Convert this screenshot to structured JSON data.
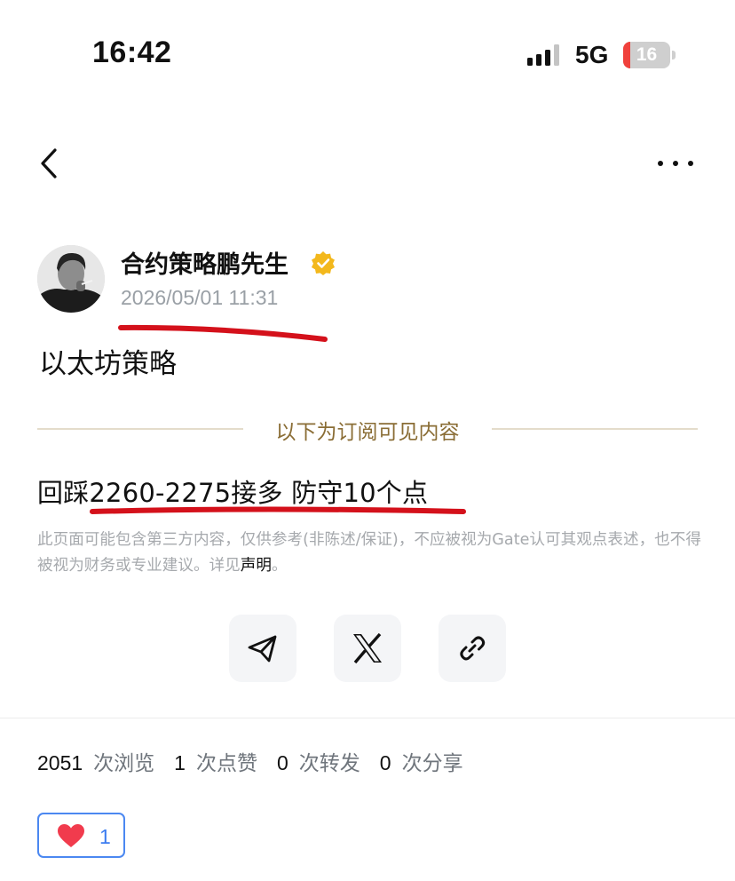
{
  "status_bar": {
    "time": "16:42",
    "network": "5G",
    "battery": "16",
    "battery_level": 0.16,
    "battery_color": "#f0413c",
    "signal_bars_active": 3,
    "signal_bars_total": 4
  },
  "nav": {
    "back_icon": "chevron-left-icon",
    "more_icon": "more-horizontal-icon"
  },
  "post": {
    "author": "合约策略鹏先生",
    "verified_icon": "verified-badge-icon",
    "verified_color": "#f3b81c",
    "timestamp": "2026/05/01 11:31",
    "title": "以太坊策略",
    "subscription_label": "以下为订阅可见内容",
    "subscription_color": "#8a6d35",
    "strategy_text": "回踩2260-2275接多 防守10个点",
    "disclaimer_text": "此页面可能包含第三方内容，仅供参考(非陈述/保证)，不应被视为Gate认可其观点表述，也不得被视为财务或专业建议。详见",
    "disclaimer_link": "声明",
    "disclaimer_end": "。",
    "annotation_color": "#d4111b"
  },
  "share": {
    "buttons": [
      {
        "icon": "telegram-icon"
      },
      {
        "icon": "x-icon"
      },
      {
        "icon": "link-icon"
      }
    ]
  },
  "stats": {
    "views": "2051",
    "views_label": "次浏览",
    "likes": "1",
    "likes_label": "次点赞",
    "reposts": "0",
    "reposts_label": "次转发",
    "shares": "0",
    "shares_label": "次分享"
  },
  "like_button": {
    "count": "1",
    "icon": "heart-icon",
    "accent": "#4b88f1"
  }
}
